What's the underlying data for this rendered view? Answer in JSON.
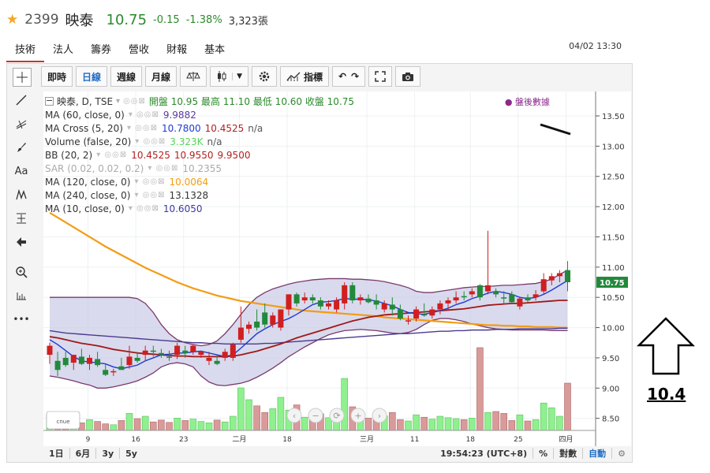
{
  "header": {
    "star_icon": "star-icon",
    "code": "2399",
    "name": "映泰",
    "price": "10.75",
    "change": "-0.15",
    "change_pct": "-1.38%",
    "volume": "3,323張"
  },
  "tabs": [
    "技術",
    "法人",
    "籌券",
    "營收",
    "財報",
    "基本"
  ],
  "datetime": "04/02 13:30",
  "left_tools": [
    "crosshair-icon",
    "trendline-icon",
    "fib-icon",
    "brush-icon",
    "text-icon",
    "pattern-icon",
    "measure-icon",
    "arrow-left-icon",
    "zoom-in-icon",
    "ruler-icon",
    "more-icon"
  ],
  "left_tools_text": {
    "text": "Aa",
    "more": "•••"
  },
  "toolbar": {
    "intraday": "即時",
    "daily": "日線",
    "weekly": "週線",
    "monthly": "月線",
    "indicators": "指標"
  },
  "legend": {
    "title": "映泰, D, TSE",
    "ohlc": "開盤 10.95 最高 11.10 最低 10.60 收盤 10.75",
    "after_hours": "盤後數據",
    "rows": [
      {
        "label": "MA (60, close, 0)",
        "values": [
          "9.9882"
        ],
        "colors": [
          "#5b3a9e"
        ]
      },
      {
        "label": "MA Cross (5, 20)",
        "values": [
          "10.7800",
          "10.4525",
          "n/a"
        ],
        "colors": [
          "#1e3bd1",
          "#b22222",
          "#555"
        ]
      },
      {
        "label": "Volume (false, 20)",
        "values": [
          "3.323K",
          "n/a"
        ],
        "colors": [
          "#5ad15a",
          "#555"
        ]
      },
      {
        "label": "BB (20, 2)",
        "values": [
          "10.4525",
          "10.9550",
          "9.9500"
        ],
        "colors": [
          "#b22222",
          "#b22222",
          "#b22222"
        ]
      },
      {
        "label": "SAR (0.02, 0.02, 0.2)",
        "values": [
          "10.2355"
        ],
        "colors": [
          "#aaa"
        ]
      },
      {
        "label": "MA (120, close, 0)",
        "values": [
          "10.0064"
        ],
        "colors": [
          "#f39c12"
        ]
      },
      {
        "label": "MA (240, close, 0)",
        "values": [
          "13.1328"
        ],
        "colors": [
          "#333"
        ]
      },
      {
        "label": "MA (10, close, 0)",
        "values": [
          "10.6050"
        ],
        "colors": [
          "#3a3a9e"
        ]
      }
    ]
  },
  "chart_data": {
    "type": "candlestick",
    "ylim": [
      8.3,
      13.8
    ],
    "y_ticks": [
      "13.50",
      "13.00",
      "12.50",
      "12.00",
      "11.50",
      "11.00",
      "10.50",
      "10.00",
      "9.50",
      "9.00",
      "8.50"
    ],
    "x_tick_labels": [
      "9",
      "16",
      "23",
      "二月",
      "18",
      "三月",
      "11",
      "18",
      "25",
      "四月"
    ],
    "last_price_label": "10.75",
    "candles": [
      {
        "o": 9.55,
        "h": 9.75,
        "l": 9.4,
        "c": 9.7,
        "v": 340
      },
      {
        "o": 9.45,
        "h": 9.6,
        "l": 9.2,
        "c": 9.3,
        "v": 200
      },
      {
        "o": 9.5,
        "h": 9.6,
        "l": 9.35,
        "c": 9.38,
        "v": 260
      },
      {
        "o": 9.42,
        "h": 9.55,
        "l": 9.3,
        "c": 9.55,
        "v": 320
      },
      {
        "o": 9.52,
        "h": 9.65,
        "l": 9.38,
        "c": 9.4,
        "v": 160
      },
      {
        "o": 9.4,
        "h": 9.55,
        "l": 9.3,
        "c": 9.5,
        "v": 230
      },
      {
        "o": 9.48,
        "h": 9.6,
        "l": 9.35,
        "c": 9.38,
        "v": 190
      },
      {
        "o": 9.3,
        "h": 9.4,
        "l": 9.2,
        "c": 9.22,
        "v": 140
      },
      {
        "o": 9.26,
        "h": 9.32,
        "l": 9.2,
        "c": 9.28,
        "v": 120
      },
      {
        "o": 9.36,
        "h": 9.5,
        "l": 9.3,
        "c": 9.3,
        "v": 210
      },
      {
        "o": 9.38,
        "h": 9.7,
        "l": 9.32,
        "c": 9.52,
        "v": 360
      },
      {
        "o": 9.5,
        "h": 9.6,
        "l": 9.42,
        "c": 9.45,
        "v": 250
      },
      {
        "o": 9.55,
        "h": 9.7,
        "l": 9.45,
        "c": 9.62,
        "v": 300
      },
      {
        "o": 9.62,
        "h": 9.7,
        "l": 9.52,
        "c": 9.6,
        "v": 180
      },
      {
        "o": 9.58,
        "h": 9.65,
        "l": 9.5,
        "c": 9.55,
        "v": 220
      },
      {
        "o": 9.52,
        "h": 9.62,
        "l": 9.45,
        "c": 9.5,
        "v": 170
      },
      {
        "o": 9.55,
        "h": 9.75,
        "l": 9.48,
        "c": 9.7,
        "v": 260
      },
      {
        "o": 9.62,
        "h": 9.7,
        "l": 9.5,
        "c": 9.58,
        "v": 210
      },
      {
        "o": 9.6,
        "h": 9.72,
        "l": 9.55,
        "c": 9.7,
        "v": 240
      },
      {
        "o": 9.55,
        "h": 9.62,
        "l": 9.5,
        "c": 9.6,
        "v": 190
      },
      {
        "o": 9.45,
        "h": 9.6,
        "l": 9.38,
        "c": 9.5,
        "v": 160
      },
      {
        "o": 9.45,
        "h": 9.55,
        "l": 9.38,
        "c": 9.4,
        "v": 220
      },
      {
        "o": 9.5,
        "h": 9.65,
        "l": 9.45,
        "c": 9.6,
        "v": 180
      },
      {
        "o": 9.5,
        "h": 9.75,
        "l": 9.45,
        "c": 9.72,
        "v": 300
      },
      {
        "o": 9.8,
        "h": 10.35,
        "l": 9.75,
        "c": 10.0,
        "v": 900
      },
      {
        "o": 9.98,
        "h": 10.1,
        "l": 9.9,
        "c": 10.05,
        "v": 650
      },
      {
        "o": 10.1,
        "h": 10.3,
        "l": 9.95,
        "c": 10.0,
        "v": 520
      },
      {
        "o": 10.25,
        "h": 10.4,
        "l": 10.0,
        "c": 10.05,
        "v": 380
      },
      {
        "o": 10.05,
        "h": 10.25,
        "l": 10.0,
        "c": 10.2,
        "v": 460
      },
      {
        "o": 10.0,
        "h": 10.3,
        "l": 9.95,
        "c": 10.3,
        "v": 700
      },
      {
        "o": 10.3,
        "h": 10.55,
        "l": 10.2,
        "c": 10.55,
        "v": 430
      },
      {
        "o": 10.55,
        "h": 10.58,
        "l": 10.35,
        "c": 10.4,
        "v": 540
      },
      {
        "o": 10.45,
        "h": 10.58,
        "l": 10.4,
        "c": 10.5,
        "v": 280
      },
      {
        "o": 10.5,
        "h": 10.55,
        "l": 10.4,
        "c": 10.45,
        "v": 320
      },
      {
        "o": 10.45,
        "h": 10.5,
        "l": 10.3,
        "c": 10.35,
        "v": 350
      },
      {
        "o": 10.35,
        "h": 10.45,
        "l": 10.3,
        "c": 10.4,
        "v": 270
      },
      {
        "o": 10.3,
        "h": 10.5,
        "l": 10.25,
        "c": 10.45,
        "v": 420
      },
      {
        "o": 10.4,
        "h": 10.75,
        "l": 10.3,
        "c": 10.7,
        "v": 1100
      },
      {
        "o": 10.7,
        "h": 10.75,
        "l": 10.4,
        "c": 10.45,
        "v": 500
      },
      {
        "o": 10.45,
        "h": 10.55,
        "l": 10.38,
        "c": 10.5,
        "v": 300
      },
      {
        "o": 10.48,
        "h": 10.55,
        "l": 10.4,
        "c": 10.42,
        "v": 260
      },
      {
        "o": 10.45,
        "h": 10.55,
        "l": 10.3,
        "c": 10.38,
        "v": 340
      },
      {
        "o": 10.3,
        "h": 10.45,
        "l": 10.25,
        "c": 10.4,
        "v": 310
      },
      {
        "o": 10.38,
        "h": 10.5,
        "l": 10.2,
        "c": 10.3,
        "v": 380
      },
      {
        "o": 10.3,
        "h": 10.38,
        "l": 10.12,
        "c": 10.15,
        "v": 230
      },
      {
        "o": 10.1,
        "h": 10.2,
        "l": 10.05,
        "c": 10.12,
        "v": 200
      },
      {
        "o": 10.15,
        "h": 10.35,
        "l": 10.1,
        "c": 10.3,
        "v": 330
      },
      {
        "o": 10.22,
        "h": 10.4,
        "l": 10.18,
        "c": 10.2,
        "v": 280
      },
      {
        "o": 10.2,
        "h": 10.35,
        "l": 10.15,
        "c": 10.3,
        "v": 240
      },
      {
        "o": 10.3,
        "h": 10.45,
        "l": 10.22,
        "c": 10.4,
        "v": 300
      },
      {
        "o": 10.4,
        "h": 10.5,
        "l": 10.3,
        "c": 10.45,
        "v": 270
      },
      {
        "o": 10.45,
        "h": 10.6,
        "l": 10.4,
        "c": 10.5,
        "v": 250
      },
      {
        "o": 10.52,
        "h": 10.6,
        "l": 10.45,
        "c": 10.5,
        "v": 230
      },
      {
        "o": 10.55,
        "h": 10.65,
        "l": 10.5,
        "c": 10.6,
        "v": 260
      },
      {
        "o": 10.7,
        "h": 10.72,
        "l": 10.45,
        "c": 10.5,
        "v": 1750
      },
      {
        "o": 10.6,
        "h": 11.6,
        "l": 10.55,
        "c": 10.7,
        "v": 380
      },
      {
        "o": 10.6,
        "h": 10.65,
        "l": 10.5,
        "c": 10.55,
        "v": 400
      },
      {
        "o": 10.5,
        "h": 10.6,
        "l": 10.4,
        "c": 10.48,
        "v": 360
      },
      {
        "o": 10.55,
        "h": 10.6,
        "l": 10.4,
        "c": 10.42,
        "v": 210
      },
      {
        "o": 10.35,
        "h": 10.5,
        "l": 10.3,
        "c": 10.48,
        "v": 330
      },
      {
        "o": 10.5,
        "h": 10.55,
        "l": 10.42,
        "c": 10.45,
        "v": 200
      },
      {
        "o": 10.5,
        "h": 10.62,
        "l": 10.45,
        "c": 10.55,
        "v": 230
      },
      {
        "o": 10.6,
        "h": 10.9,
        "l": 10.55,
        "c": 10.8,
        "v": 580
      },
      {
        "o": 10.78,
        "h": 10.9,
        "l": 10.7,
        "c": 10.85,
        "v": 480
      },
      {
        "o": 10.85,
        "h": 10.95,
        "l": 10.75,
        "c": 10.9,
        "v": 300
      },
      {
        "o": 10.95,
        "h": 11.1,
        "l": 10.6,
        "c": 10.75,
        "v": 1000
      }
    ],
    "lines": {
      "ma120": [
        11.9,
        11.82,
        11.74,
        11.66,
        11.58,
        11.5,
        11.42,
        11.34,
        11.27,
        11.2,
        11.13,
        11.06,
        10.99,
        10.93,
        10.87,
        10.81,
        10.75,
        10.7,
        10.65,
        10.61,
        10.57,
        10.53,
        10.5,
        10.47,
        10.44,
        10.42,
        10.4,
        10.38,
        10.36,
        10.34,
        10.32,
        10.3,
        10.28,
        10.27,
        10.26,
        10.25,
        10.24,
        10.23,
        10.22,
        10.21,
        10.2,
        10.19,
        10.17,
        10.16,
        10.15,
        10.14,
        10.13,
        10.12,
        10.11,
        10.1,
        10.09,
        10.08,
        10.07,
        10.06,
        10.05,
        10.04,
        10.04,
        10.03,
        10.03,
        10.02,
        10.02,
        10.01,
        10.01,
        10.01,
        10.0,
        10.0
      ],
      "ma60": [
        9.95,
        9.93,
        9.91,
        9.9,
        9.89,
        9.88,
        9.87,
        9.86,
        9.85,
        9.84,
        9.83,
        9.82,
        9.81,
        9.8,
        9.79,
        9.78,
        9.77,
        9.76,
        9.75,
        9.75,
        9.74,
        9.74,
        9.73,
        9.73,
        9.73,
        9.73,
        9.73,
        9.74,
        9.74,
        9.75,
        9.76,
        9.77,
        9.78,
        9.79,
        9.8,
        9.81,
        9.82,
        9.83,
        9.84,
        9.85,
        9.86,
        9.87,
        9.88,
        9.89,
        9.9,
        9.9,
        9.91,
        9.92,
        9.93,
        9.94,
        9.94,
        9.95,
        9.95,
        9.96,
        9.96,
        9.96,
        9.97,
        9.97,
        9.97,
        9.98,
        9.98,
        9.98,
        9.98,
        9.98,
        9.99,
        9.99
      ],
      "ma20": [
        9.85,
        9.83,
        9.8,
        9.77,
        9.74,
        9.72,
        9.7,
        9.67,
        9.64,
        9.62,
        9.6,
        9.58,
        9.57,
        9.56,
        9.55,
        9.54,
        9.53,
        9.53,
        9.52,
        9.52,
        9.52,
        9.52,
        9.52,
        9.53,
        9.55,
        9.58,
        9.61,
        9.65,
        9.69,
        9.73,
        9.78,
        9.83,
        9.87,
        9.91,
        9.95,
        9.99,
        10.03,
        10.07,
        10.11,
        10.14,
        10.17,
        10.19,
        10.21,
        10.22,
        10.23,
        10.24,
        10.25,
        10.26,
        10.27,
        10.28,
        10.29,
        10.3,
        10.31,
        10.33,
        10.35,
        10.37,
        10.38,
        10.39,
        10.4,
        10.4,
        10.41,
        10.42,
        10.43,
        10.44,
        10.45,
        10.45
      ],
      "ma5": [
        9.8,
        9.72,
        9.62,
        9.52,
        9.45,
        9.43,
        9.42,
        9.4,
        9.35,
        9.32,
        9.35,
        9.38,
        9.45,
        9.5,
        9.55,
        9.56,
        9.58,
        9.58,
        9.6,
        9.61,
        9.58,
        9.55,
        9.52,
        9.55,
        9.66,
        9.78,
        9.9,
        9.98,
        10.05,
        10.1,
        10.15,
        10.22,
        10.3,
        10.38,
        10.42,
        10.43,
        10.45,
        10.48,
        10.47,
        10.47,
        10.46,
        10.44,
        10.4,
        10.36,
        10.3,
        10.25,
        10.23,
        10.22,
        10.25,
        10.28,
        10.32,
        10.38,
        10.42,
        10.48,
        10.52,
        10.57,
        10.6,
        10.58,
        10.55,
        10.5,
        10.48,
        10.5,
        10.55,
        10.62,
        10.7,
        10.78
      ]
    },
    "bb": {
      "upper": [
        10.5,
        10.5,
        10.5,
        10.5,
        10.5,
        10.5,
        10.5,
        10.5,
        10.5,
        10.5,
        10.5,
        10.48,
        10.4,
        10.25,
        10.05,
        9.9,
        9.8,
        9.75,
        9.72,
        9.7,
        9.72,
        9.78,
        9.9,
        10.05,
        10.22,
        10.38,
        10.5,
        10.58,
        10.64,
        10.68,
        10.72,
        10.75,
        10.77,
        10.79,
        10.8,
        10.81,
        10.81,
        10.81,
        10.8,
        10.8,
        10.79,
        10.78,
        10.76,
        10.73,
        10.7,
        10.66,
        10.6,
        10.58,
        10.58,
        10.6,
        10.62,
        10.64,
        10.66,
        10.67,
        10.68,
        10.68,
        10.69,
        10.7,
        10.7,
        10.71,
        10.72,
        10.73,
        10.76,
        10.8,
        10.88,
        10.95
      ],
      "lower": [
        9.2,
        9.18,
        9.15,
        9.12,
        9.08,
        9.05,
        9.0,
        9.0,
        9.02,
        9.05,
        9.08,
        9.12,
        9.18,
        9.25,
        9.35,
        9.4,
        9.42,
        9.4,
        9.35,
        9.2,
        9.1,
        9.05,
        9.04,
        9.06,
        9.08,
        9.12,
        9.18,
        9.25,
        9.33,
        9.42,
        9.52,
        9.6,
        9.68,
        9.75,
        9.82,
        9.88,
        9.92,
        9.95,
        9.96,
        9.97,
        9.96,
        9.95,
        9.93,
        9.91,
        9.9,
        9.92,
        9.97,
        10.05,
        10.12,
        10.15,
        10.15,
        10.13,
        10.1,
        10.06,
        10.03,
        10.0,
        9.98,
        9.97,
        9.96,
        9.96,
        9.96,
        9.96,
        9.96,
        9.95,
        9.95,
        9.95
      ]
    },
    "volume_ylim": [
      0,
      2000
    ],
    "range_buttons": [
      "1日",
      "6月",
      "3y",
      "5y"
    ],
    "clock": "19:54:23 (UTC+8)",
    "percent": "%",
    "log": "對數",
    "auto": "自動"
  },
  "annotation": {
    "value": "10.4"
  }
}
